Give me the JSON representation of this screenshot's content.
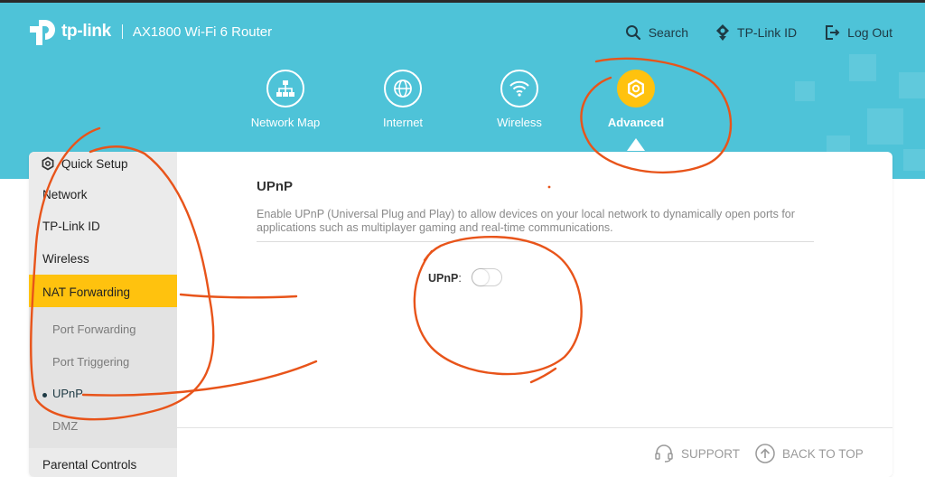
{
  "brand": {
    "logo_text": "tp-link",
    "model": "AX1800 Wi-Fi 6 Router"
  },
  "toplinks": [
    {
      "label": "Search",
      "icon": "search-icon"
    },
    {
      "label": "TP-Link ID",
      "icon": "tplink-id-icon"
    },
    {
      "label": "Log Out",
      "icon": "logout-icon"
    }
  ],
  "nav": [
    {
      "label": "Network Map",
      "icon": "network-map-icon"
    },
    {
      "label": "Internet",
      "icon": "globe-icon"
    },
    {
      "label": "Wireless",
      "icon": "wifi-icon"
    },
    {
      "label": "Advanced",
      "icon": "gear-icon",
      "active": true
    }
  ],
  "sidebar": {
    "items": [
      {
        "label": "Quick Setup",
        "icon": "gear-icon"
      },
      {
        "label": "Network"
      },
      {
        "label": "TP-Link ID"
      },
      {
        "label": "Wireless"
      },
      {
        "label": "NAT Forwarding",
        "active": true
      },
      {
        "label": "Parental Controls"
      }
    ],
    "subitems": [
      {
        "label": "Port Forwarding"
      },
      {
        "label": "Port Triggering"
      },
      {
        "label": "UPnP",
        "active": true
      },
      {
        "label": "DMZ"
      }
    ]
  },
  "content": {
    "title": "UPnP",
    "description": "Enable UPnP (Universal Plug and Play) to allow devices on your local network to dynamically open ports for applications such as multiplayer gaming and real-time communications.",
    "field_label": "UPnP",
    "field_colon": ":",
    "toggle_on": false
  },
  "footer": {
    "support": "SUPPORT",
    "back_to_top": "BACK TO TOP"
  },
  "colors": {
    "header": "#4ec3d8",
    "accent": "#ffc20e",
    "annotation": "#e8541a"
  }
}
